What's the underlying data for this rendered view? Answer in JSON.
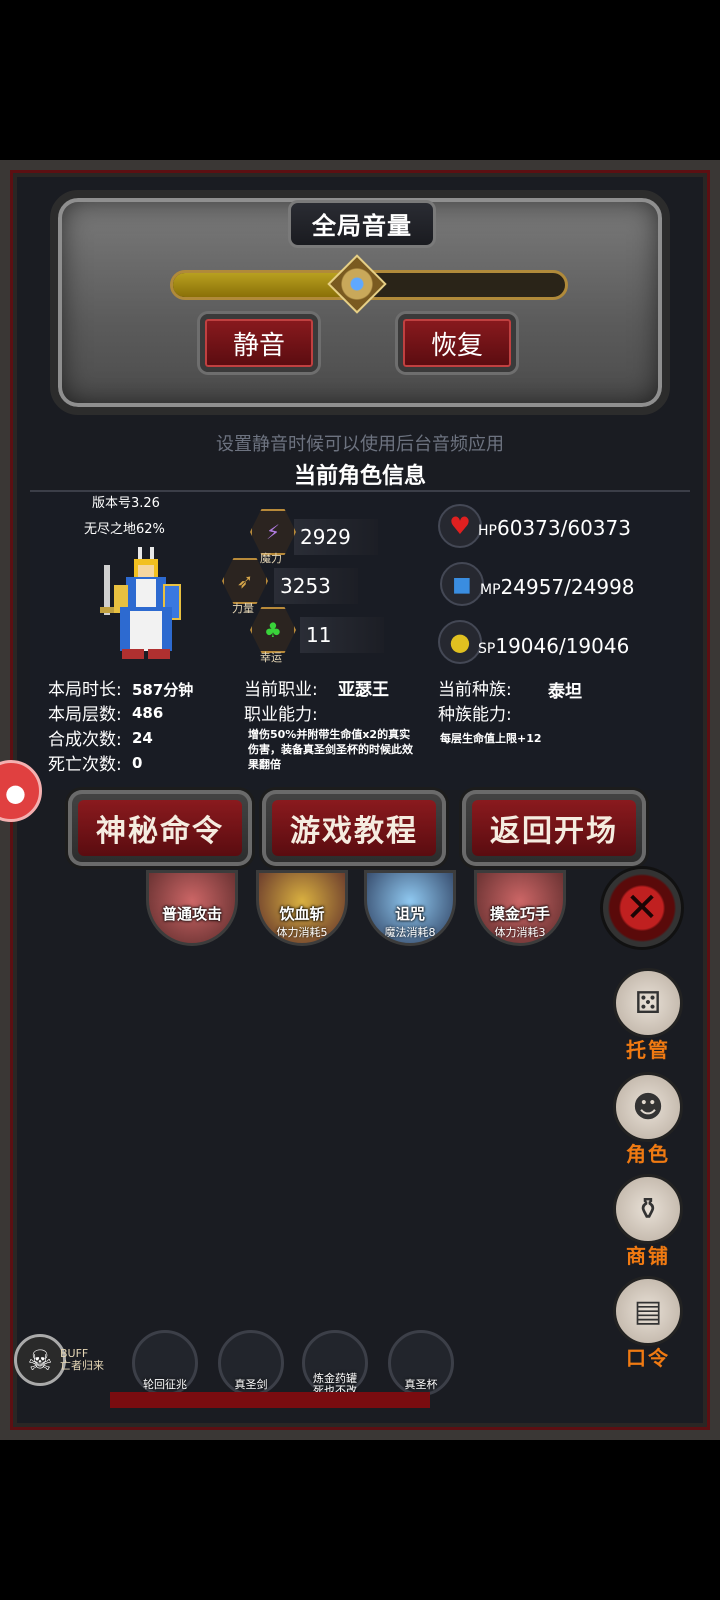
{
  "volume": {
    "title": "全局音量",
    "level_fraction": 0.47,
    "mute_label": "静音",
    "restore_label": "恢复",
    "hint": "设置静音时候可以使用后台音频应用"
  },
  "character": {
    "section_title": "当前角色信息",
    "version": "版本号3.26",
    "dungeon": "无尽之地62%",
    "stats": {
      "magic": {
        "value": "2929",
        "label": "魔力",
        "icon": "lightning-icon"
      },
      "strength": {
        "value": "3253",
        "label": "力量",
        "icon": "crossbow-icon"
      },
      "luck": {
        "value": "11",
        "label": "幸运",
        "icon": "clover-icon"
      }
    },
    "resources": {
      "hp": {
        "label": "HP",
        "value": "60373/60373",
        "icon": "heart-icon"
      },
      "mp": {
        "label": "MP",
        "value": "24957/24998",
        "icon": "mana-icon"
      },
      "sp": {
        "label": "SP",
        "value": "19046/19046",
        "icon": "muscle-icon"
      }
    },
    "run": {
      "time_label": "本局时长:",
      "time_value": "587分钟",
      "floors_label": "本局层数:",
      "floors_value": "486",
      "craft_label": "合成次数:",
      "craft_value": "24",
      "death_label": "死亡次数:",
      "death_value": "0"
    },
    "job": {
      "label": "当前职业:",
      "value": "亚瑟王",
      "ability_label": "职业能力:",
      "ability_desc": "增伤50%并附带生命值x2的真实伤害，装备真圣剑圣杯的时候此效果翻倍"
    },
    "race": {
      "label": "当前种族:",
      "value": "泰坦",
      "ability_label": "种族能力:",
      "ability_desc": "每层生命值上限+12"
    }
  },
  "actions": {
    "secret_label": "神秘命令",
    "tutorial_label": "游戏教程",
    "return_label": "返回开场"
  },
  "skills": [
    {
      "name": "普通攻击",
      "cost": ""
    },
    {
      "name": "饮血斩",
      "cost": "体力消耗5"
    },
    {
      "name": "诅咒",
      "cost": "魔法消耗8"
    },
    {
      "name": "摸金巧手",
      "cost": "体力消耗3"
    }
  ],
  "side_nav": {
    "auto": "托管",
    "role": "角色",
    "shop": "商铺",
    "code": "口令"
  },
  "buff": {
    "title": "BUFF",
    "name": "亡者归来"
  },
  "items": [
    {
      "name": "轮回征兆"
    },
    {
      "name": "真圣剑"
    },
    {
      "name": "炼金药罐\n死也不改"
    },
    {
      "name": "真圣杯"
    }
  ],
  "colors": {
    "accent_red": "#8a1a1e",
    "nav_orange": "#f07a12",
    "slider_gold": "#b8a020"
  }
}
